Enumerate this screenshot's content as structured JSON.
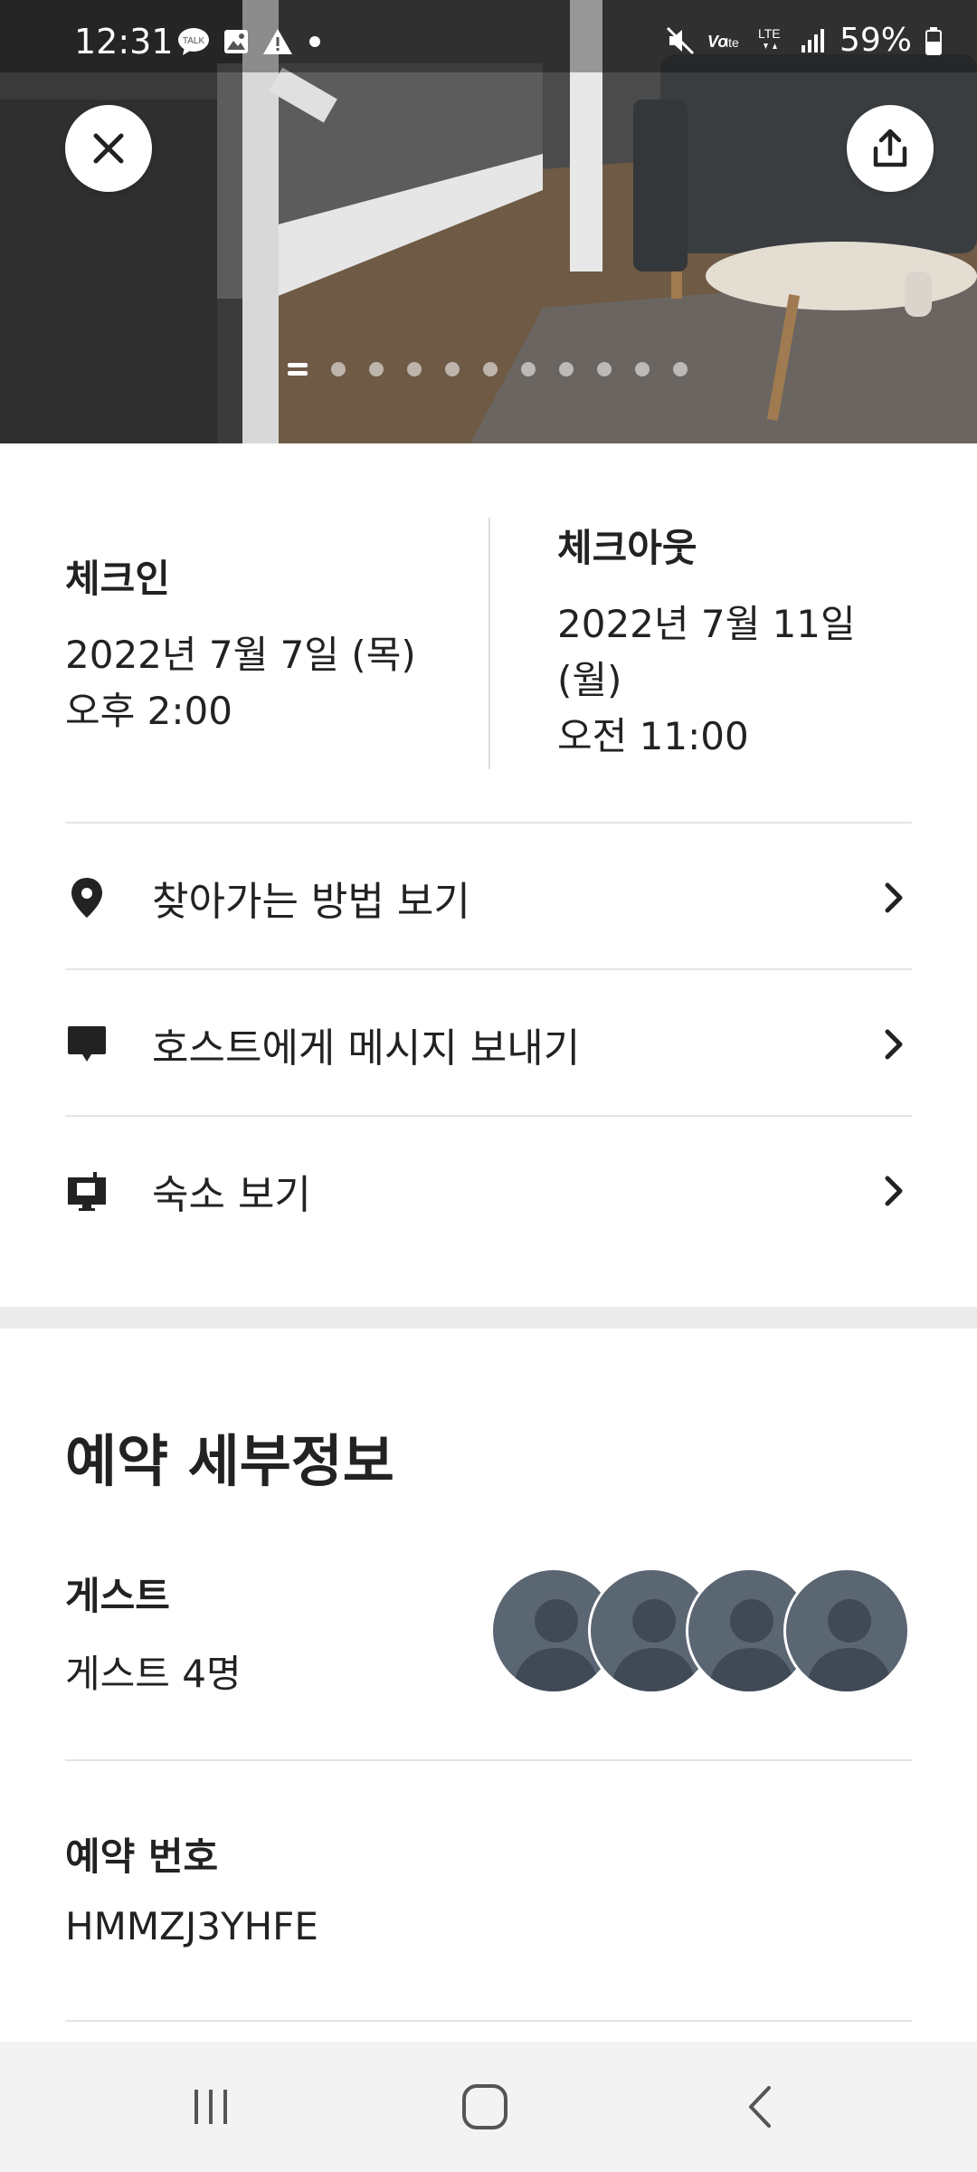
{
  "status_bar": {
    "time": "12:31",
    "battery": "59%",
    "network": "LTE",
    "left_icons": [
      "talk-icon",
      "image-icon",
      "warning-icon",
      "dot-icon"
    ],
    "right_icons": [
      "mute-icon",
      "volte-icon",
      "lte-icon",
      "signal-icon",
      "battery-icon"
    ]
  },
  "hero": {
    "photo_count": 11,
    "active_photo": 1
  },
  "checkin": {
    "label": "체크인",
    "date": "2022년 7월 7일 (목)",
    "time": "오후 2:00"
  },
  "checkout": {
    "label": "체크아웃",
    "date_line1": "2022년 7월 11일",
    "date_line2": "(월)",
    "time": "오전 11:00"
  },
  "actions": [
    {
      "label": "찾아가는 방법 보기",
      "icon": "location-pin-icon"
    },
    {
      "label": "호스트에게 메시지 보내기",
      "icon": "message-icon"
    },
    {
      "label": "숙소 보기",
      "icon": "listing-icon"
    }
  ],
  "details": {
    "title": "예약 세부정보",
    "guests_label": "게스트",
    "guests_value": "게스트 4명",
    "guest_avatar_count": 4,
    "reservation_label": "예약 번호",
    "reservation_value": "HMMZJ3YHFE"
  },
  "colors": {
    "text": "#222222",
    "divider": "#e4e4e4",
    "avatar": "#5b6673",
    "nav_bg": "#f3f3f3"
  }
}
